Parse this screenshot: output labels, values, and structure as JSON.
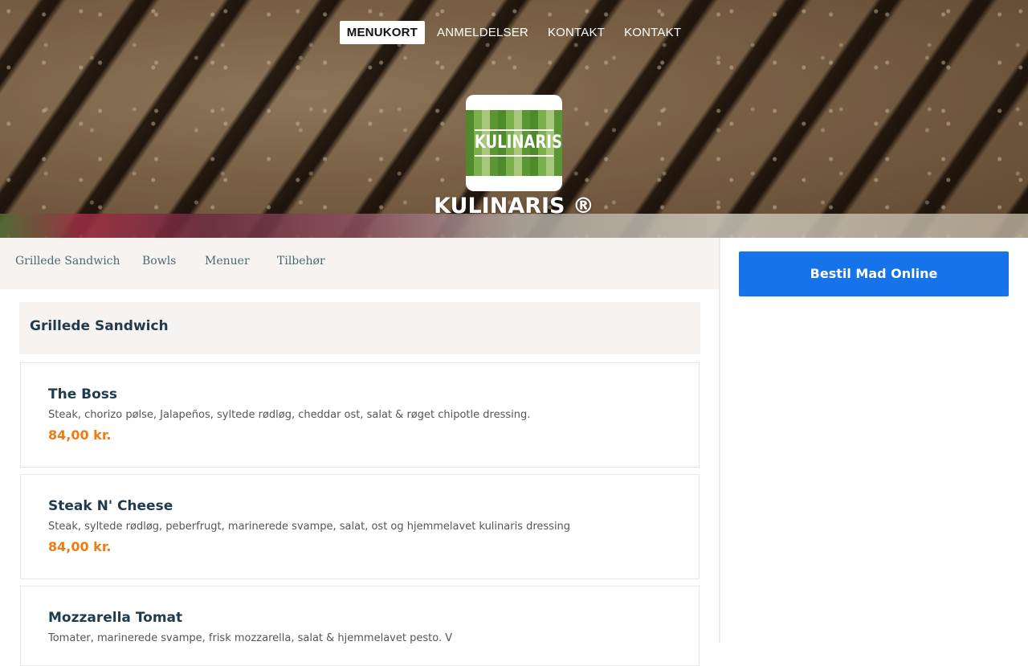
{
  "top_nav": {
    "items": [
      {
        "label": "MENUKORT",
        "active": true
      },
      {
        "label": "ANMELDELSER",
        "active": false
      },
      {
        "label": "KONTAKT",
        "active": false
      },
      {
        "label": "KONTAKT",
        "active": false
      }
    ]
  },
  "brand": {
    "logo_text": "KULINARIS",
    "title": "KULINARIS ®"
  },
  "categories": [
    "Grillede Sandwich",
    "Bowls",
    "Menuer",
    "Tilbehør"
  ],
  "section": {
    "title": "Grillede Sandwich",
    "items": [
      {
        "name": "The Boss",
        "description": "Steak, chorizo pølse, Jalapeños, syltede rødløg, cheddar ost, salat & røget chipotle dressing.",
        "price": "84,00 kr."
      },
      {
        "name": "Steak N' Cheese",
        "description": "Steak, syltede rødløg, peberfrugt, marinerede svampe, salat, ost og hjemmelavet kulinaris dressing",
        "price": "84,00 kr."
      },
      {
        "name": "Mozzarella Tomat",
        "description": "Tomater, marinerede svampe, frisk mozzarella, salat & hjemmelavet pesto. V",
        "price": ""
      }
    ]
  },
  "order_button": {
    "label": "Bestil Mad Online"
  },
  "colors": {
    "accent_blue": "#1673ea",
    "price_orange": "#f07b12",
    "heading_navy": "#1f3b4d",
    "panel_beige": "#f7f3f0"
  }
}
